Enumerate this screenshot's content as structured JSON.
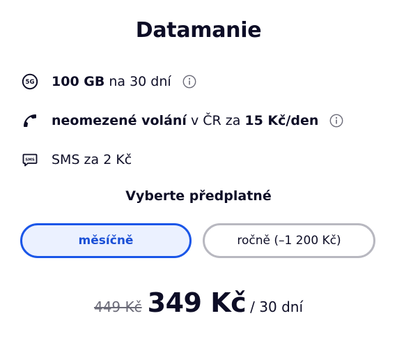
{
  "title": "Datamanie",
  "features": [
    {
      "icon": "5g-icon",
      "bold1": "100 GB",
      "text1": "na 30 dní",
      "bold2": "",
      "has_info": true
    },
    {
      "icon": "phone-icon",
      "bold1": "neomezené volání",
      "text1": "v ČR za",
      "bold2": "15 Kč/den",
      "has_info": true
    },
    {
      "icon": "sms-icon",
      "bold1": "",
      "text1": "SMS za 2 Kč",
      "bold2": "",
      "has_info": false
    }
  ],
  "subscription": {
    "heading": "Vyberte předplatné",
    "options": [
      {
        "label": "měsíčně",
        "selected": true
      },
      {
        "label": "ročně (–1 200 Kč)",
        "selected": false
      }
    ]
  },
  "price": {
    "old": "449 Kč",
    "current": "349 Kč",
    "period": "/ 30 dní"
  },
  "colors": {
    "text": "#0d0d26",
    "accent": "#1a56e8",
    "selected_bg": "#ebf1ff",
    "border_inactive": "#b8b8c0",
    "muted": "#6b6b78"
  }
}
